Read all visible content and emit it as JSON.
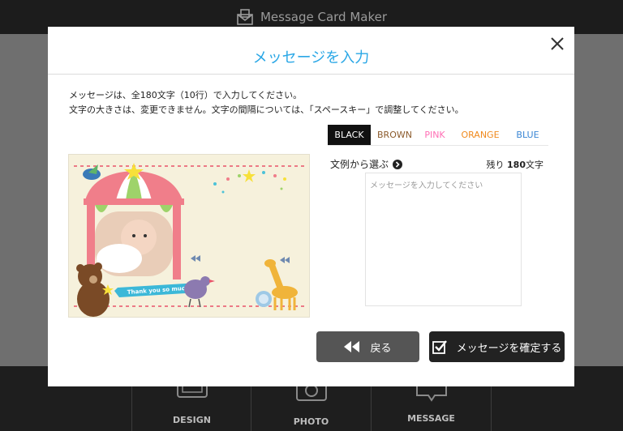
{
  "app": {
    "title": "Message Card Maker"
  },
  "footer": {
    "tabs": [
      {
        "label": "DESIGN"
      },
      {
        "label": "PHOTO"
      },
      {
        "label": "MESSAGE"
      }
    ]
  },
  "modal": {
    "title": "メッセージを入力",
    "instructions": [
      "メッセージは、全180文字（10行）で入力してください。",
      "文字の大きさは、変更できません。文字の間隔については、「スペースキー」で調整してください。"
    ],
    "color_tabs": [
      {
        "label": "BLACK",
        "color": "#ffffff"
      },
      {
        "label": "BROWN",
        "color": "#8b5a2b"
      },
      {
        "label": "PINK",
        "color": "#ff6fb5"
      },
      {
        "label": "ORANGE",
        "color": "#f08a1e"
      },
      {
        "label": "BLUE",
        "color": "#3a86d4"
      }
    ],
    "active_color": "BLACK",
    "card": {
      "banner_text": "Thank you so much"
    },
    "sample_link": "文例から選ぶ",
    "remaining": {
      "prefix": "残り",
      "count": "180",
      "suffix": "文字"
    },
    "message_placeholder": "メッセージを入力してください",
    "message_value": "",
    "back_label": "戻る",
    "confirm_label": "メッセージを確定する"
  },
  "colors": {
    "title_blue": "#2aa7e6",
    "back_btn": "#555555",
    "confirm_btn": "#222222"
  }
}
